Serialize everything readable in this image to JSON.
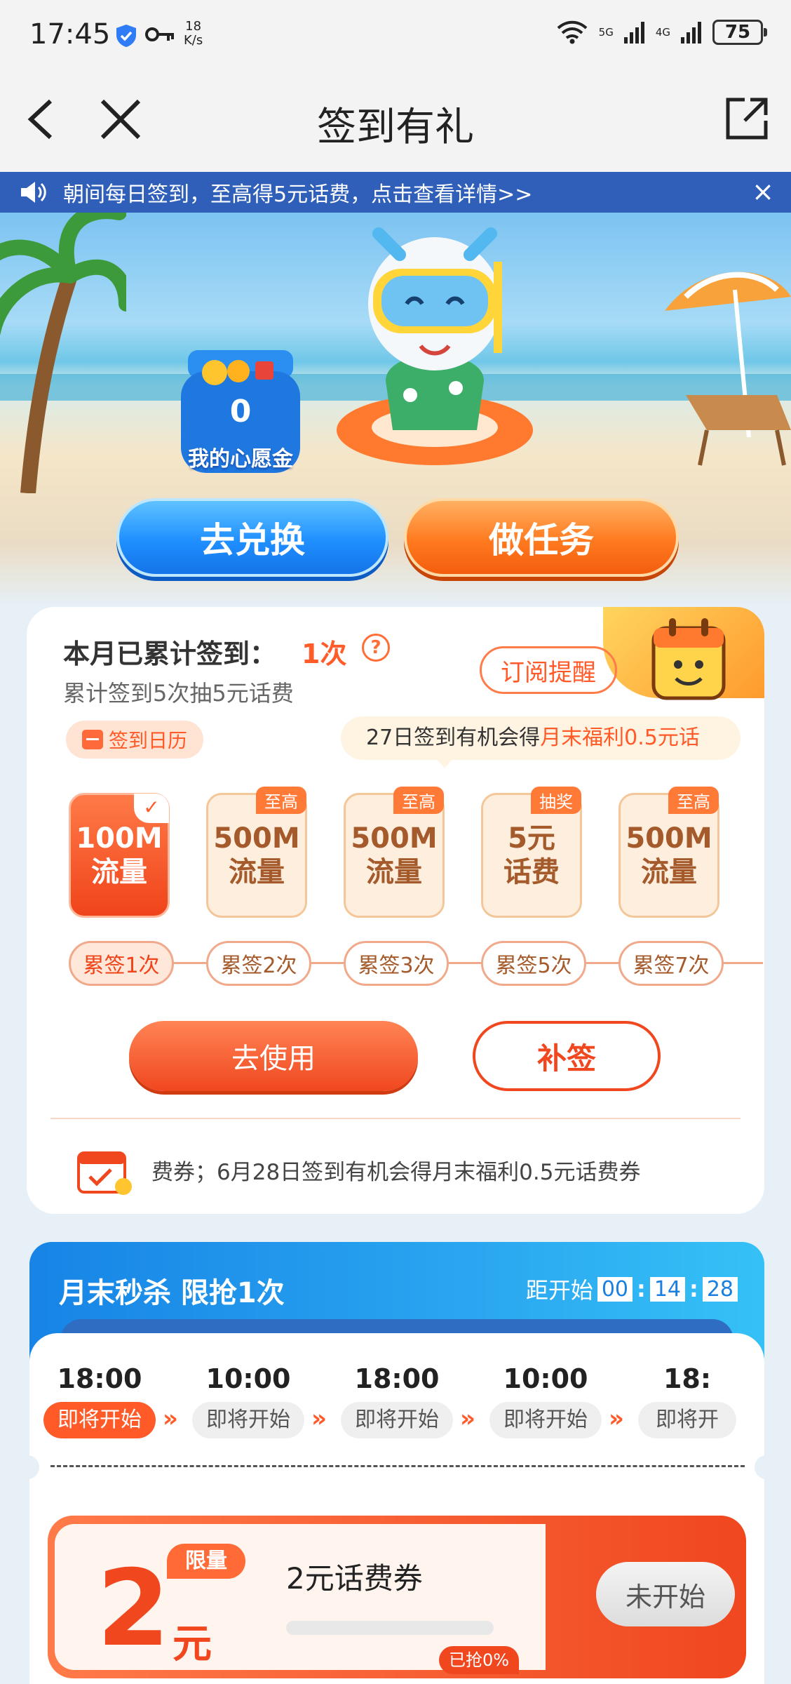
{
  "status_bar": {
    "time": "17:45",
    "speed_value": "18",
    "speed_unit": "K/s",
    "net1": "5G",
    "net2": "4G",
    "battery": "75"
  },
  "nav": {
    "title": "签到有礼"
  },
  "notice": {
    "text": "朝间每日签到，至高得5元话费，点击查看详情>>",
    "close": "×"
  },
  "hero": {
    "wish_gold_count": "0",
    "wish_gold_label": "我的心愿金",
    "exchange_label": "去兑换",
    "task_label": "做任务"
  },
  "checkin": {
    "monthly_label": "本月已累计签到：",
    "monthly_count": "1次",
    "help": "?",
    "subtitle": "累计签到5次抽5元话费",
    "subscribe_label": "订阅提醒",
    "calendar_label": "签到日历",
    "tip_prefix": "27日签到有机会得",
    "tip_highlight": "月末福利0.5元话",
    "rewards": [
      {
        "amount": "100M",
        "unit": "流量",
        "tag": ""
      },
      {
        "amount": "500M",
        "unit": "流量",
        "tag": "至高"
      },
      {
        "amount": "500M",
        "unit": "流量",
        "tag": "至高"
      },
      {
        "amount": "5元",
        "unit": "话费",
        "tag": "抽奖"
      },
      {
        "amount": "500M",
        "unit": "流量",
        "tag": "至高"
      }
    ],
    "milestones": [
      "累签1次",
      "累签2次",
      "累签3次",
      "累签5次",
      "累签7次"
    ],
    "use_label": "去使用",
    "makeup_label": "补签",
    "coupon_info": "费券；6月28日签到有机会得月末福利0.5元话费券"
  },
  "flash_sale": {
    "title": "月末秒杀 限抢1次",
    "countdown_label": "距开始",
    "countdown": [
      "00",
      "14",
      "28"
    ],
    "sessions": [
      {
        "time": "18:00",
        "state": "即将开始"
      },
      {
        "time": "10:00",
        "state": "即将开始"
      },
      {
        "time": "18:00",
        "state": "即将开始"
      },
      {
        "time": "10:00",
        "state": "即将开始"
      },
      {
        "time": "18:",
        "state": "即将开"
      }
    ],
    "chevron": "»",
    "coupon": {
      "amount": "2",
      "unit": "元",
      "tag": "限量",
      "name": "2元话费券",
      "progress": 0,
      "sold_label": "已抢0%",
      "button_label": "未开始"
    }
  },
  "colors": {
    "accent": "#ff5a28",
    "notice_bg": "#2f5fb8",
    "flash_blue": "#1784e6"
  }
}
